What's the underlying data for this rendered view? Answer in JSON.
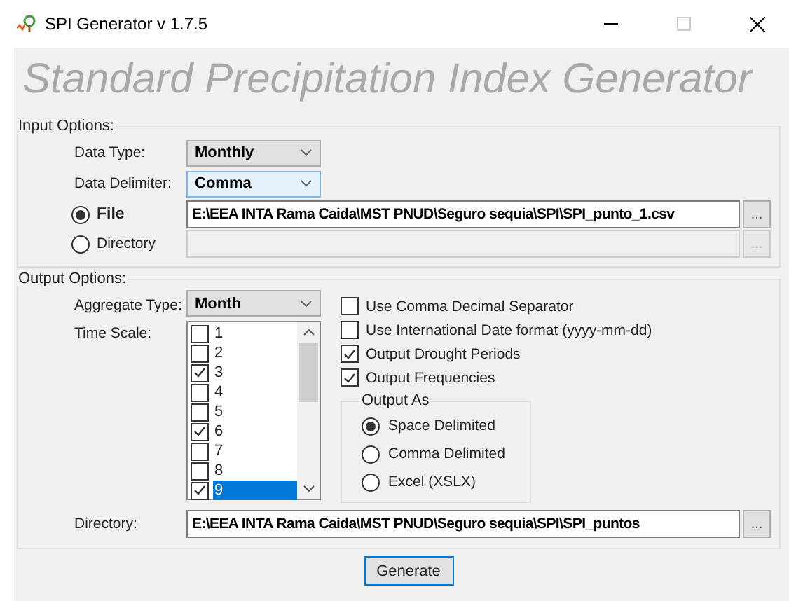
{
  "window": {
    "title": "SPI Generator  v 1.7.5"
  },
  "heading": "Standard Precipitation Index Generator",
  "input_options": {
    "label": "Input Options:",
    "data_type": {
      "label": "Data Type:",
      "value": "Monthly",
      "focused": false
    },
    "data_delimiter": {
      "label": "Data Delimiter:",
      "value": "Comma",
      "focused": true
    },
    "sources": [
      {
        "label": "File",
        "selected": true,
        "path": "E:\\EEA INTA Rama Caida\\MST PNUD\\Seguro sequia\\SPI\\SPI_punto_1.csv",
        "browse": "..."
      },
      {
        "label": "Directory",
        "selected": false,
        "browse": "..."
      }
    ]
  },
  "output_options": {
    "label": "Output Options:",
    "aggregate_type": {
      "label": "Aggregate Type:",
      "value": "Month"
    },
    "time_scale": {
      "label": "Time Scale:",
      "items": [
        {
          "label": "1",
          "checked": false,
          "selected": false
        },
        {
          "label": "2",
          "checked": false,
          "selected": false
        },
        {
          "label": "3",
          "checked": true,
          "selected": false
        },
        {
          "label": "4",
          "checked": false,
          "selected": false
        },
        {
          "label": "5",
          "checked": false,
          "selected": false
        },
        {
          "label": "6",
          "checked": true,
          "selected": false
        },
        {
          "label": "7",
          "checked": false,
          "selected": false
        },
        {
          "label": "8",
          "checked": false,
          "selected": false
        },
        {
          "label": "9",
          "checked": true,
          "selected": true
        }
      ]
    },
    "checkboxes": [
      {
        "label": "Use Comma Decimal Separator",
        "checked": false
      },
      {
        "label": "Use International Date format (yyyy-mm-dd)",
        "checked": false
      },
      {
        "label": "Output Drought Periods",
        "checked": true
      },
      {
        "label": "Output Frequencies",
        "checked": true
      }
    ],
    "output_as": {
      "label": "Output As",
      "options": [
        {
          "label": "Space Delimited",
          "selected": true
        },
        {
          "label": "Comma Delimited",
          "selected": false
        },
        {
          "label": "Excel (XSLX)",
          "selected": false
        }
      ]
    },
    "directory": {
      "label": "Directory:",
      "path": "E:\\EEA INTA Rama Caida\\MST PNUD\\Seguro sequia\\SPI\\SPI_puntos",
      "browse": "..."
    }
  },
  "generate_button": "Generate"
}
